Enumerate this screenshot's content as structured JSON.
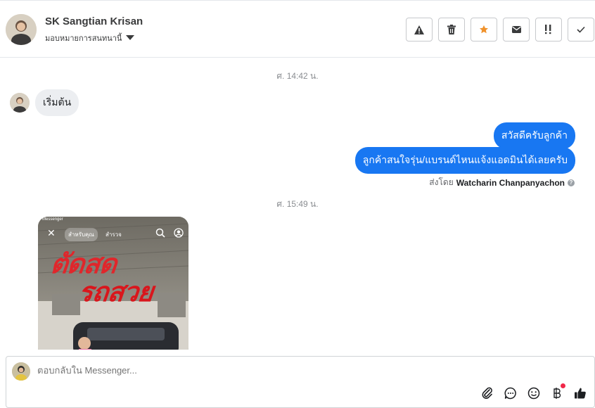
{
  "header": {
    "contact_name": "SK Sangtian Krisan",
    "assign_label": "มอบหมายการสนทนานี้",
    "actions": [
      {
        "name": "report-spam-button",
        "icon": "warning-icon"
      },
      {
        "name": "delete-button",
        "icon": "trash-icon"
      },
      {
        "name": "star-button",
        "icon": "star-icon",
        "color": "#f0922b"
      },
      {
        "name": "mark-unread-button",
        "icon": "envelope-icon"
      },
      {
        "name": "follow-up-button",
        "icon": "flag-icon"
      },
      {
        "name": "mark-done-button",
        "icon": "check-icon"
      }
    ]
  },
  "thread": {
    "timestamp_1": "ศ. 14:42 น.",
    "incoming_1": "เริ่มต้น",
    "outgoing_1": "สวัสดีครับลูกค้า",
    "outgoing_2": "ลูกค้าสนใจรุ่น/แบรนด์ไหนแจ้งแอดมินได้เลยครับ",
    "sent_by_prefix": "ส่งโดย",
    "sent_by_name": "Watcharin Chanpanyachon",
    "timestamp_2": "ศ. 15:49 น.",
    "media": {
      "top_bar_label": "Messenger",
      "tab_for_you": "สำหรับคุณ",
      "tab_explore": "สำรวจ",
      "headline_1": "ตัดสด",
      "headline_2": "รถสวย"
    }
  },
  "composer": {
    "placeholder": "ตอบกลับใน Messenger...",
    "tools": [
      "attach-icon",
      "chat-bubble-icon",
      "emoji-icon",
      "baht-icon",
      "thumbs-up-icon"
    ]
  },
  "colors": {
    "accent": "#1877f2",
    "star": "#f0922b",
    "badge": "#f02849"
  }
}
